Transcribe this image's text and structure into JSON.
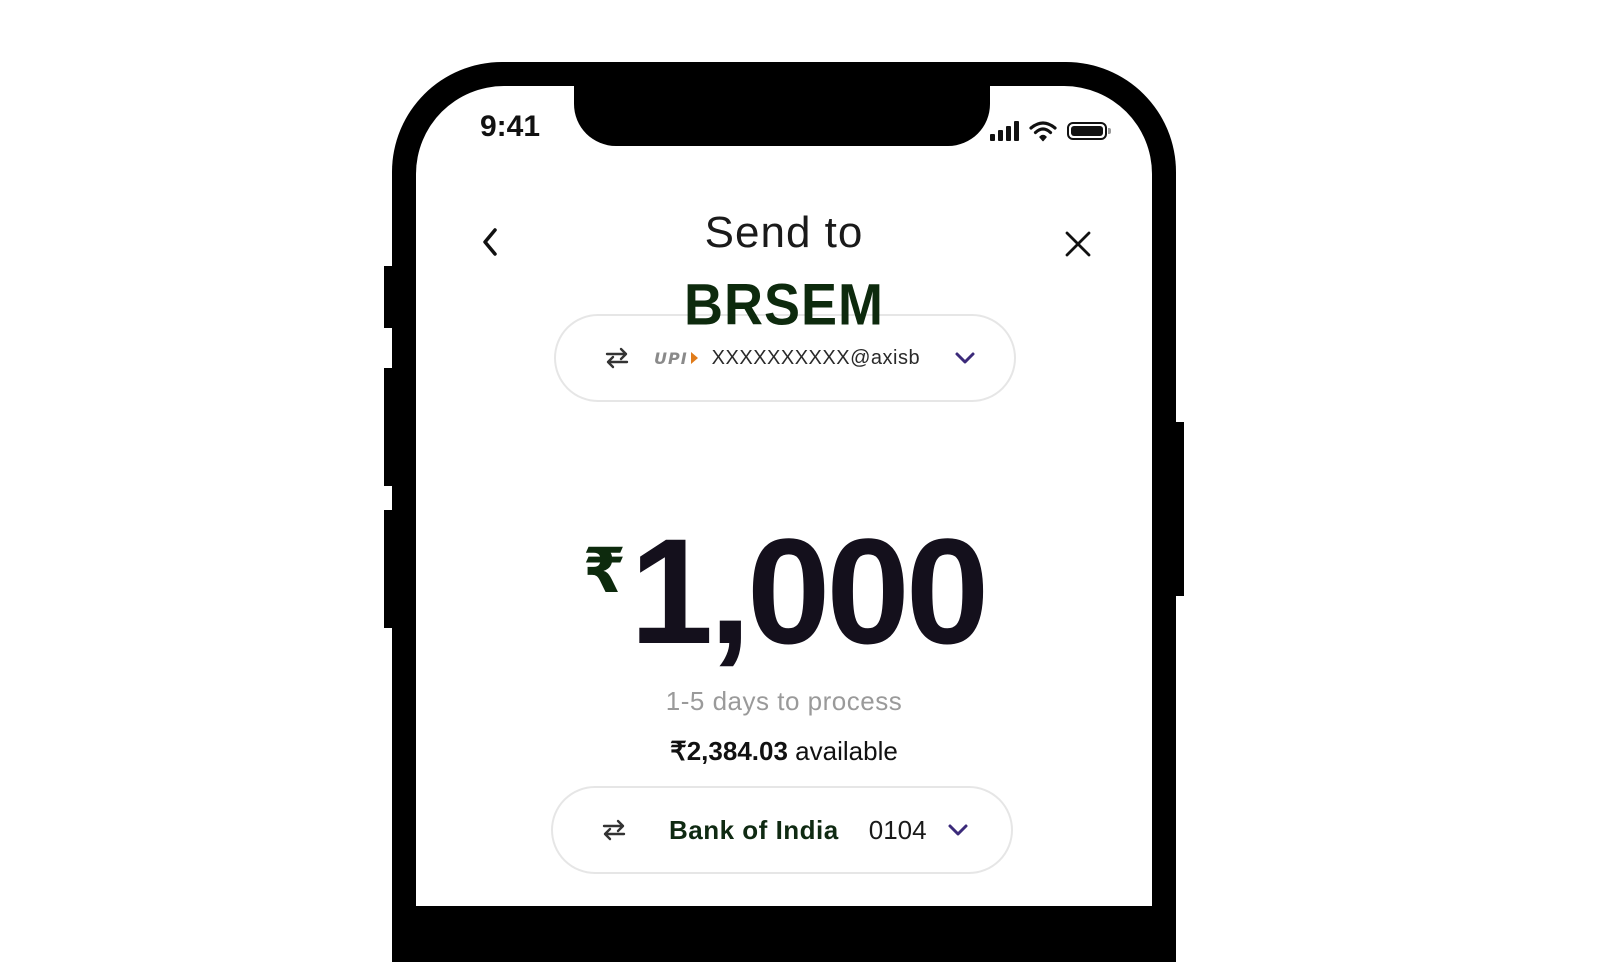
{
  "status_bar": {
    "time": "9:41",
    "icons": [
      "signal-icon",
      "wifi-icon",
      "battery-icon"
    ]
  },
  "header": {
    "back_icon": "chevron-left-icon",
    "title": "Send to",
    "close_icon": "close-icon"
  },
  "recipient": {
    "name": "BRSEM",
    "upi_logo": "UPI",
    "upi_id": "XXXXXXXXXX@axisb",
    "swap_icon": "swap-icon",
    "dropdown_icon": "chevron-down-icon"
  },
  "amount": {
    "currency_symbol": "₹",
    "value": "1,000"
  },
  "processing_note": "1-5 days to process",
  "balance": {
    "currency_symbol": "₹",
    "amount": "2,384.03",
    "suffix": "available"
  },
  "source_account": {
    "bank_name": "Bank of India",
    "account_suffix": "0104",
    "swap_icon": "swap-icon",
    "dropdown_icon": "chevron-down-icon"
  },
  "colors": {
    "accent": "#3b2a7a",
    "recipient_text": "#0d2a0d",
    "muted_text": "#9a9a9a",
    "pill_border": "#e6e6e6"
  }
}
